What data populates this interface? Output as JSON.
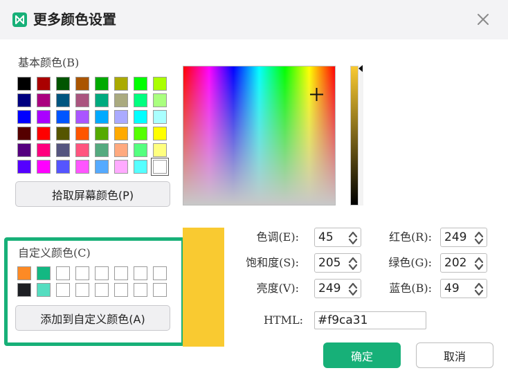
{
  "window": {
    "title": "更多颜色设置",
    "app_icon": "mindmap-app-icon",
    "close_icon": "close-icon"
  },
  "basic_colors": {
    "label": "基本颜色(B)",
    "swatches": [
      "#000000",
      "#aa0000",
      "#005500",
      "#aa5500",
      "#00aa00",
      "#aaaa00",
      "#00ff00",
      "#aaff00",
      "#00007f",
      "#aa007f",
      "#00557f",
      "#aa557f",
      "#00aa7f",
      "#aaaa7f",
      "#00ff7f",
      "#aaff7f",
      "#0000ff",
      "#aa00ff",
      "#0055ff",
      "#aa55ff",
      "#00aaff",
      "#aaaaff",
      "#00ffff",
      "#aaffff",
      "#550000",
      "#ff0000",
      "#555500",
      "#ff5500",
      "#55aa00",
      "#ffaa00",
      "#55ff00",
      "#ffff00",
      "#55007f",
      "#ff007f",
      "#55557f",
      "#ff557f",
      "#55aa7f",
      "#ffaa7f",
      "#55ff7f",
      "#ffff7f",
      "#5500ff",
      "#ff00ff",
      "#5555ff",
      "#ff55ff",
      "#55aaff",
      "#ffaaff",
      "#55ffff",
      "#ffffff"
    ],
    "selected_index": 47
  },
  "pick_screen_button": "拾取屏幕颜色(P)",
  "custom_colors": {
    "label": "自定义颜色(C)",
    "swatches": [
      "#fd8a25",
      "#13b882",
      "#ffffff",
      "#ffffff",
      "#ffffff",
      "#ffffff",
      "#ffffff",
      "#ffffff",
      "#1d1f23",
      "#55ddc0",
      "#ffffff",
      "#ffffff",
      "#ffffff",
      "#ffffff",
      "#ffffff",
      "#ffffff"
    ]
  },
  "add_custom_button": "添加到自定义颜色(A)",
  "current_color": "#f9ca31",
  "fields": {
    "hue": {
      "label": "色调(E):",
      "value": "45"
    },
    "saturation": {
      "label": "饱和度(S):",
      "value": "205"
    },
    "brightness": {
      "label": "亮度(V):",
      "value": "249"
    },
    "red": {
      "label": "红色(R):",
      "value": "249"
    },
    "green": {
      "label": "绿色(G):",
      "value": "202"
    },
    "blue": {
      "label": "蓝色(B):",
      "value": "49"
    },
    "html": {
      "label": "HTML:",
      "value": "#f9ca31"
    }
  },
  "buttons": {
    "ok": "确定",
    "cancel": "取消"
  },
  "accent_color": "#17b078"
}
